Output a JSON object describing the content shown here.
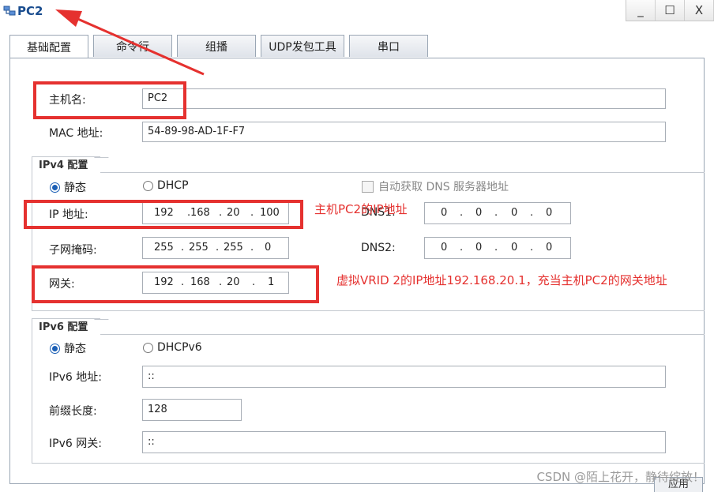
{
  "window": {
    "title": "PC2",
    "minimize_glyph": "_",
    "maximize_glyph": "☐",
    "close_glyph": "X"
  },
  "tabs": [
    "基础配置",
    "命令行",
    "组播",
    "UDP发包工具",
    "串口"
  ],
  "host": {
    "name_label": "主机名:",
    "name_value": "PC2",
    "mac_label": "MAC 地址:",
    "mac_value": "54-89-98-AD-1F-F7"
  },
  "ipv4": {
    "section_title": "IPv4 配置",
    "static_label": "静态",
    "dhcp_label": "DHCP",
    "auto_dns_label": "自动获取 DNS 服务器地址",
    "ip_label": "IP 地址:",
    "ip": [
      "192",
      "168",
      "20",
      "100"
    ],
    "mask_label": "子网掩码:",
    "mask": [
      "255",
      "255",
      "255",
      "0"
    ],
    "gateway_label": "网关:",
    "gateway": [
      "192",
      "168",
      "20",
      "1"
    ],
    "dns1_label": "DNS1:",
    "dns1": [
      "0",
      "0",
      "0",
      "0"
    ],
    "dns2_label": "DNS2:",
    "dns2": [
      "0",
      "0",
      "0",
      "0"
    ]
  },
  "ipv6": {
    "section_title": "IPv6 配置",
    "static_label": "静态",
    "dhcpv6_label": "DHCPv6",
    "addr_label": "IPv6 地址:",
    "addr_value": "::",
    "prefix_label": "前缀长度:",
    "prefix_value": "128",
    "gateway_label": "IPv6 网关:",
    "gateway_value": "::"
  },
  "annotations": {
    "ip_note": "主机PC2的IP地址",
    "gateway_note": "虚拟VRID 2的IP地址192.168.20.1，充当主机PC2的网关地址"
  },
  "apply_label": "应用",
  "watermark": "CSDN @陌上花开，静待绽放！",
  "colors": {
    "annotation_red": "#e5312f",
    "radio_blue": "#1b5fb5",
    "title_blue": "#1a4d8f"
  }
}
